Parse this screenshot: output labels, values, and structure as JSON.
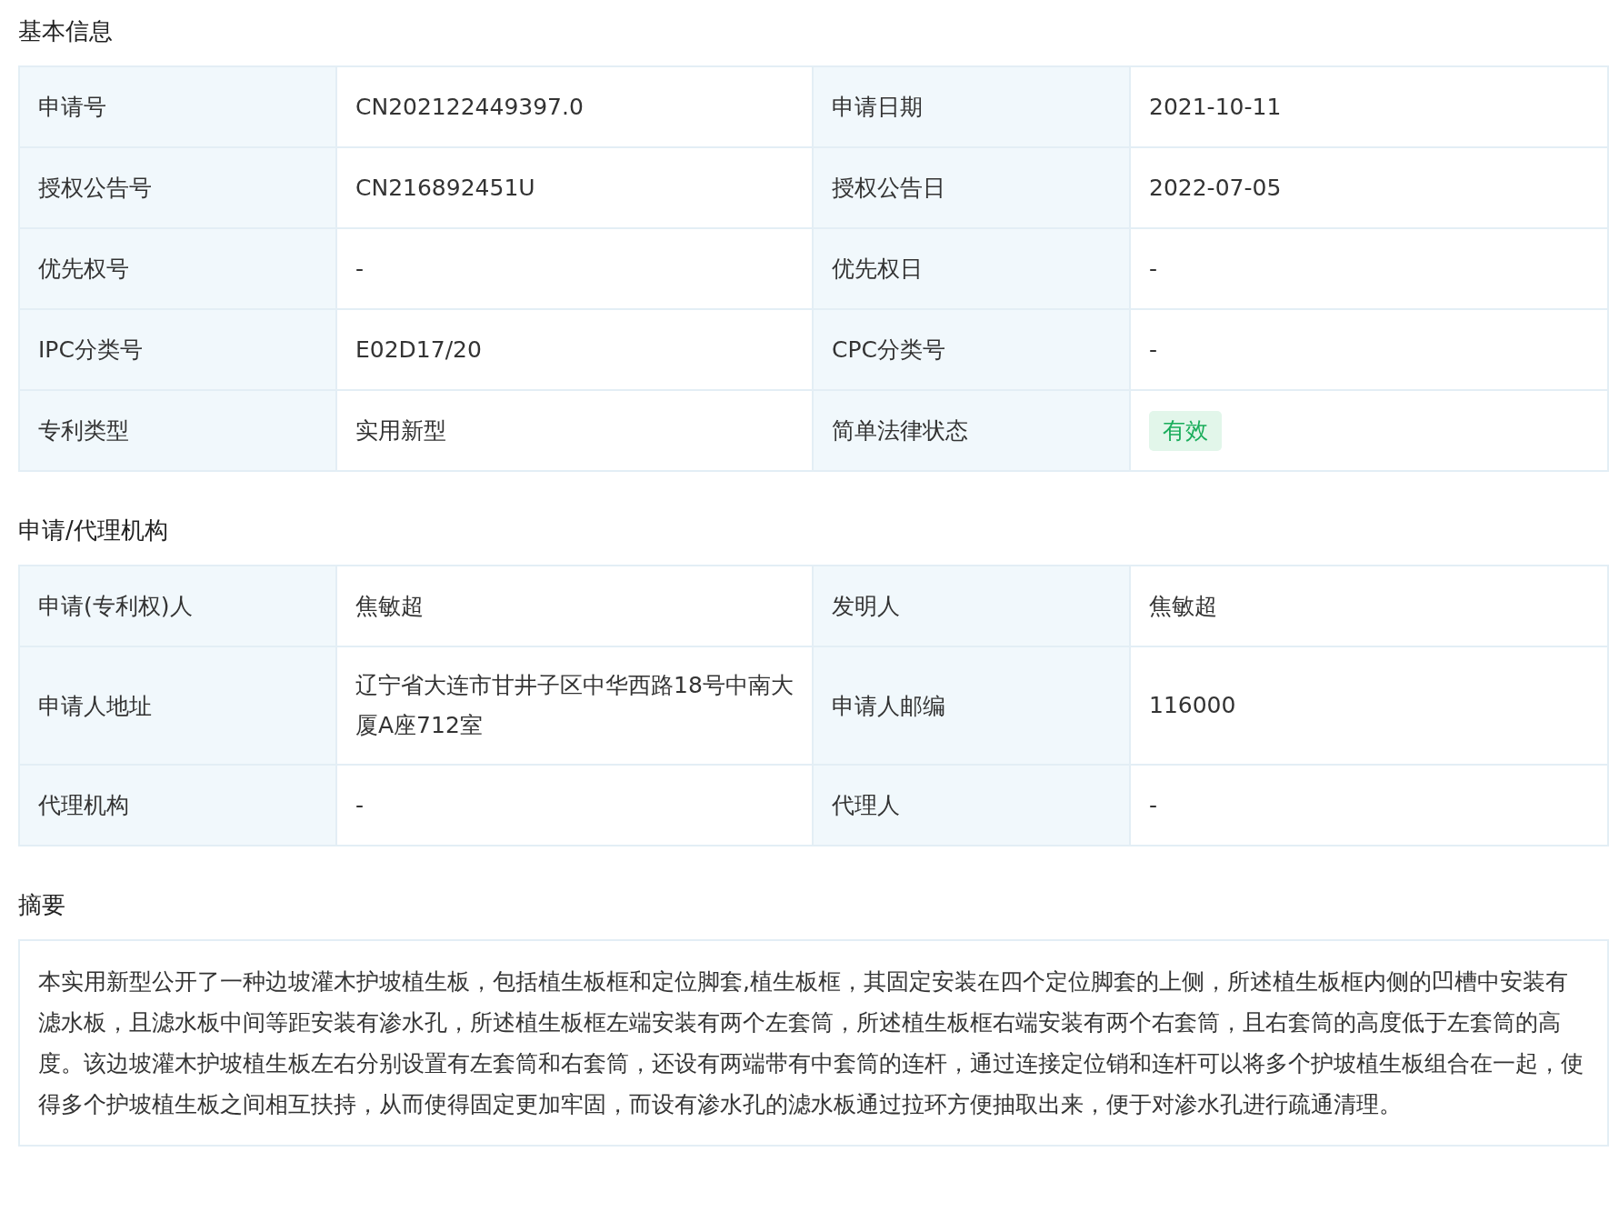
{
  "sections": [
    {
      "kind": "table",
      "title": "基本信息",
      "rows": [
        [
          {
            "label": "申请号",
            "value": "CN202122449397.0",
            "kind": "text"
          },
          {
            "label": "申请日期",
            "value": "2021-10-11",
            "kind": "text"
          }
        ],
        [
          {
            "label": "授权公告号",
            "value": "CN216892451U",
            "kind": "text"
          },
          {
            "label": "授权公告日",
            "value": "2022-07-05",
            "kind": "text"
          }
        ],
        [
          {
            "label": "优先权号",
            "value": "-",
            "kind": "text"
          },
          {
            "label": "优先权日",
            "value": "-",
            "kind": "text"
          }
        ],
        [
          {
            "label": "IPC分类号",
            "value": "E02D17/20",
            "kind": "text"
          },
          {
            "label": "CPC分类号",
            "value": "-",
            "kind": "text"
          }
        ],
        [
          {
            "label": "专利类型",
            "value": "实用新型",
            "kind": "text"
          },
          {
            "label": "简单法律状态",
            "value": "有效",
            "kind": "tag"
          }
        ]
      ]
    },
    {
      "kind": "table",
      "title": "申请/代理机构",
      "rows": [
        [
          {
            "label": "申请(专利权)人",
            "value": "焦敏超",
            "kind": "text"
          },
          {
            "label": "发明人",
            "value": "焦敏超",
            "kind": "text"
          }
        ],
        [
          {
            "label": "申请人地址",
            "value": "辽宁省大连市甘井子区中华西路18号中南大厦A座712室",
            "kind": "text"
          },
          {
            "label": "申请人邮编",
            "value": "116000",
            "kind": "text"
          }
        ],
        [
          {
            "label": "代理机构",
            "value": "-",
            "kind": "text"
          },
          {
            "label": "代理人",
            "value": "-",
            "kind": "text"
          }
        ]
      ]
    },
    {
      "kind": "text",
      "title": "摘要",
      "text": "本实用新型公开了一种边坡灌木护坡植生板，包括植生板框和定位脚套,植生板框，其固定安装在四个定位脚套的上侧，所述植生板框内侧的凹槽中安装有滤水板，且滤水板中间等距安装有渗水孔，所述植生板框左端安装有两个左套筒，所述植生板框右端安装有两个右套筒，且右套筒的高度低于左套筒的高度。该边坡灌木护坡植生板左右分别设置有左套筒和右套筒，还设有两端带有中套筒的连杆，通过连接定位销和连杆可以将多个护坡植生板组合在一起，使得多个护坡植生板之间相互扶持，从而使得固定更加牢固，而设有渗水孔的滤水板通过拉环方便抽取出来，便于对渗水孔进行疏通清理。"
    }
  ]
}
